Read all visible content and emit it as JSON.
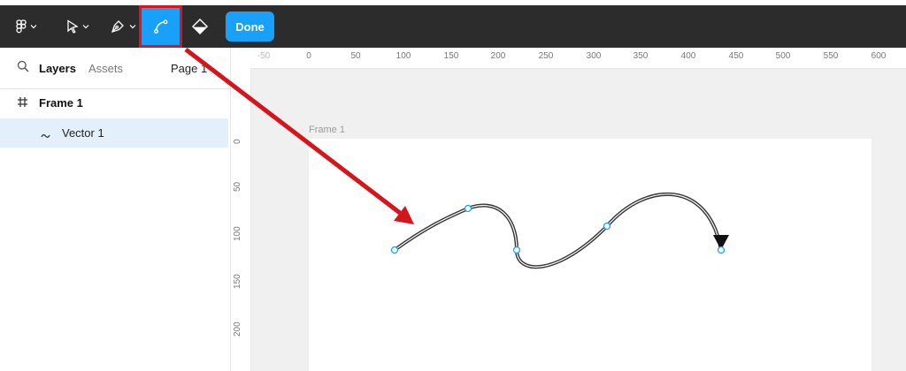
{
  "toolbar": {
    "done_label": "Done",
    "tools": [
      {
        "icon": "figma-logo-icon"
      },
      {
        "icon": "move-arrow-icon"
      },
      {
        "icon": "pen-tool-icon"
      },
      {
        "icon": "bend-vector-icon",
        "active": true
      },
      {
        "icon": "paint-bucket-icon"
      }
    ],
    "accent": "#18a0fb",
    "highlight": "#e0141a"
  },
  "left_panel": {
    "tabs": {
      "layers": "Layers",
      "assets": "Assets",
      "page": "Page 1"
    },
    "layers": [
      {
        "name": "Frame 1",
        "icon": "frame-hash-icon"
      },
      {
        "name": "Vector 1",
        "icon": "vector-squiggle-icon",
        "selected": true
      }
    ]
  },
  "canvas": {
    "frame_title": "Frame 1",
    "ruler_top": [
      "-50",
      "0",
      "50",
      "100",
      "150",
      "200",
      "250",
      "300",
      "350",
      "400",
      "450",
      "500",
      "550",
      "600"
    ],
    "ruler_left": [
      "0",
      "50",
      "100",
      "150",
      "200"
    ]
  }
}
